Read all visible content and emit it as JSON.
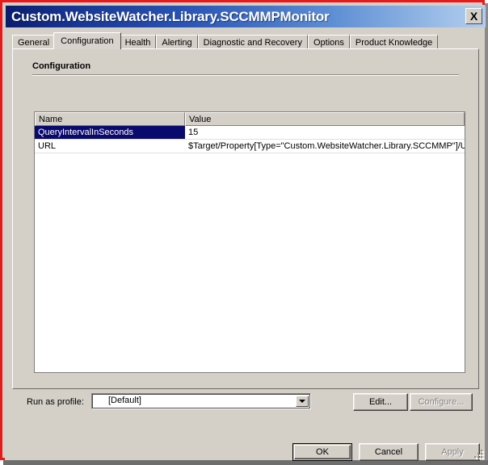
{
  "window": {
    "title": "Custom.WebsiteWatcher.Library.SCCMMPMonitor",
    "close_label": "X",
    "accent_title_start": "#0a1d6e",
    "accent_title_end": "#b2cdee",
    "frame_color": "#e8191b",
    "face_color": "#d4d0c8"
  },
  "tabs": [
    {
      "label": "General",
      "selected": false
    },
    {
      "label": "Configuration",
      "selected": true
    },
    {
      "label": "Health",
      "selected": false
    },
    {
      "label": "Alerting",
      "selected": false
    },
    {
      "label": "Diagnostic and Recovery",
      "selected": false
    },
    {
      "label": "Options",
      "selected": false
    },
    {
      "label": "Product Knowledge",
      "selected": false
    }
  ],
  "page": {
    "section_title": "Configuration"
  },
  "table": {
    "columns": [
      "Name",
      "Value"
    ],
    "selection_color": "#0a0a6e",
    "rows": [
      {
        "name": "QueryIntervalInSeconds",
        "value": "15",
        "selected": true
      },
      {
        "name": "URL",
        "value": "$Target/Property[Type=\"Custom.WebsiteWatcher.Library.SCCMMP\"]/URL$",
        "selected": false
      }
    ]
  },
  "profile": {
    "label": "Run as profile:",
    "value": "[Default]",
    "options": [
      "[Default]"
    ]
  },
  "actions": {
    "edit": {
      "label": "Edit...",
      "enabled": true
    },
    "configure": {
      "label": "Configure...",
      "enabled": false
    }
  },
  "dialog_buttons": {
    "ok": {
      "label": "OK",
      "enabled": true,
      "default": true
    },
    "cancel": {
      "label": "Cancel",
      "enabled": true
    },
    "apply": {
      "label": "Apply",
      "enabled": false
    }
  }
}
